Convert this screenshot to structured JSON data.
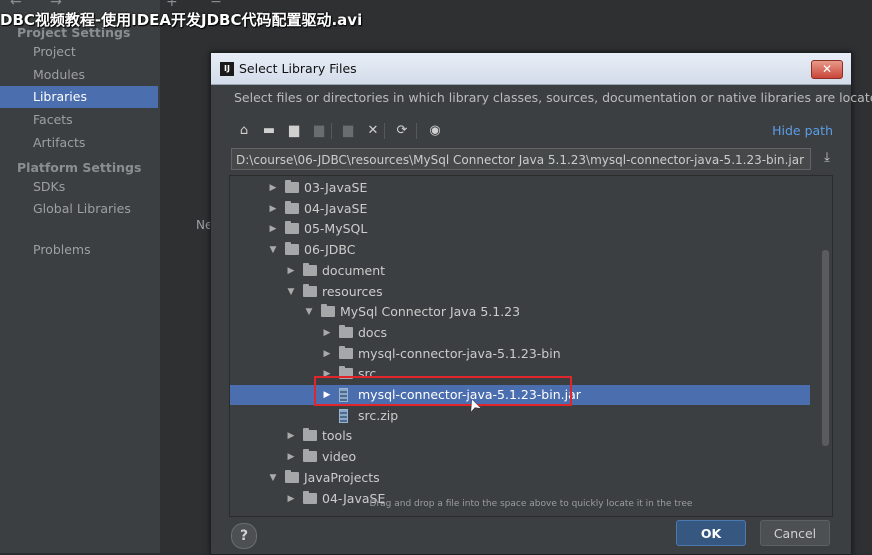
{
  "video_title": "DBC视频教程-使用IDEA开发JDBC代码配置驱动.avi",
  "top_icons": "← →",
  "top_center_icons": "+ −",
  "sidebar": {
    "sections": [
      {
        "label": "Project Settings",
        "items": [
          "Project",
          "Modules",
          "Libraries",
          "Facets",
          "Artifacts"
        ]
      },
      {
        "label": "Platform Settings",
        "items": [
          "SDKs",
          "Global Libraries"
        ]
      }
    ],
    "problems": "Problems",
    "selected": "Libraries"
  },
  "center_label": "Ne",
  "dialog": {
    "title": "Select Library Files",
    "title_icon": "IJ",
    "close_icon": "✕",
    "description": "Select files or directories in which library classes, sources, documentation or native libraries are located",
    "toolbar": [
      {
        "icon": "home-icon",
        "glyph": "⌂",
        "enabled": true
      },
      {
        "icon": "desktop-icon",
        "glyph": "▬",
        "enabled": true
      },
      {
        "icon": "project-folder-icon",
        "glyph": "▆",
        "enabled": true
      },
      {
        "icon": "module-folder-icon",
        "glyph": "▆",
        "enabled": false
      },
      {
        "icon": "new-folder-icon",
        "glyph": "▆",
        "enabled": false
      },
      {
        "icon": "delete-icon",
        "glyph": "✕",
        "enabled": true
      },
      {
        "icon": "refresh-icon",
        "glyph": "⟳",
        "enabled": true
      },
      {
        "icon": "show-hidden-icon",
        "glyph": "◉",
        "enabled": true
      }
    ],
    "hide_path": "Hide path",
    "path_value": "D:\\course\\06-JDBC\\resources\\MySql Connector Java 5.1.23\\mysql-connector-java-5.1.23-bin.jar",
    "download_icon": "⤓",
    "tree": [
      {
        "label": "03-JavaSE",
        "depth": 0,
        "expanded": false,
        "kind": "folder"
      },
      {
        "label": "04-JavaSE",
        "depth": 0,
        "expanded": false,
        "kind": "folder"
      },
      {
        "label": "05-MySQL",
        "depth": 0,
        "expanded": false,
        "kind": "folder"
      },
      {
        "label": "06-JDBC",
        "depth": 0,
        "expanded": true,
        "kind": "folder"
      },
      {
        "label": "document",
        "depth": 1,
        "expanded": false,
        "kind": "folder"
      },
      {
        "label": "resources",
        "depth": 1,
        "expanded": true,
        "kind": "folder"
      },
      {
        "label": "MySql Connector Java 5.1.23",
        "depth": 2,
        "expanded": true,
        "kind": "folder"
      },
      {
        "label": "docs",
        "depth": 3,
        "expanded": false,
        "kind": "folder"
      },
      {
        "label": "mysql-connector-java-5.1.23-bin",
        "depth": 3,
        "expanded": false,
        "kind": "folder"
      },
      {
        "label": "src",
        "depth": 3,
        "expanded": false,
        "kind": "folder"
      },
      {
        "label": "mysql-connector-java-5.1.23-bin.jar",
        "depth": 3,
        "expanded": false,
        "kind": "jar",
        "selected": true
      },
      {
        "label": "src.zip",
        "depth": 3,
        "expanded": false,
        "kind": "jar",
        "leaf": true
      },
      {
        "label": "tools",
        "depth": 1,
        "expanded": false,
        "kind": "folder"
      },
      {
        "label": "video",
        "depth": 1,
        "expanded": false,
        "kind": "folder"
      },
      {
        "label": "JavaProjects",
        "depth": 0,
        "expanded": true,
        "kind": "folder"
      },
      {
        "label": "04-JavaSE",
        "depth": 1,
        "expanded": false,
        "kind": "folder"
      }
    ],
    "hint": "Drag and drop a file into the space above to quickly locate it in the tree",
    "help_label": "?",
    "ok_label": "OK",
    "cancel_label": "Cancel"
  },
  "colors": {
    "selection": "#4b6eaf",
    "link": "#5a9ee6",
    "highlight_box": "#e0262b"
  }
}
